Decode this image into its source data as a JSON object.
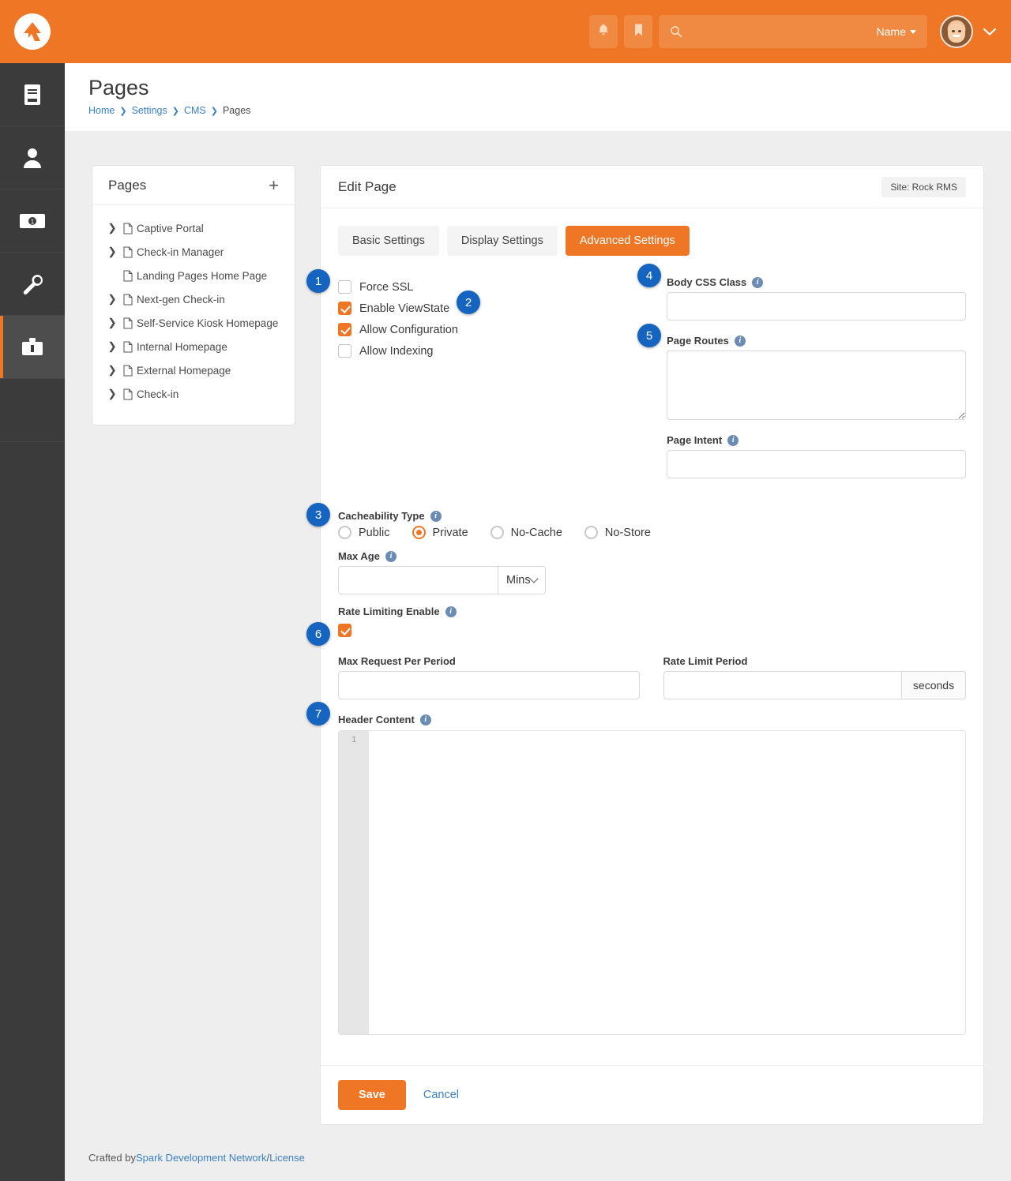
{
  "brand": {
    "accent": "#ee7624",
    "badge_color": "#1565c0",
    "link_color": "#3b81c4",
    "logo_icon": "rock-rms-logo"
  },
  "topbar": {
    "notifications_icon": "bell-icon",
    "bookmarks_icon": "bookmark-icon",
    "search_icon": "search-icon",
    "search_value": "",
    "search_placeholder": "",
    "name_label": "Name",
    "avatar_icon": "user-avatar",
    "user_caret_icon": "chevron-down-icon"
  },
  "leftnav": {
    "items": [
      {
        "icon": "book-icon",
        "active": false
      },
      {
        "icon": "person-icon",
        "active": false
      },
      {
        "icon": "money-bill-icon",
        "active": false
      },
      {
        "icon": "wrench-icon",
        "active": false
      },
      {
        "icon": "toolbox-icon",
        "active": true
      }
    ]
  },
  "header": {
    "title": "Pages",
    "breadcrumb": [
      {
        "label": "Home",
        "current": false
      },
      {
        "label": "Settings",
        "current": false
      },
      {
        "label": "CMS",
        "current": false
      },
      {
        "label": "Pages",
        "current": true
      }
    ]
  },
  "tree_panel": {
    "title": "Pages",
    "add_icon": "plus-icon",
    "items": [
      {
        "label": "Captive Portal",
        "expandable": true
      },
      {
        "label": "Check-in Manager",
        "expandable": true
      },
      {
        "label": "Landing Pages Home Page",
        "expandable": false
      },
      {
        "label": "Next-gen Check-in",
        "expandable": true
      },
      {
        "label": "Self-Service Kiosk Homepage",
        "expandable": true
      },
      {
        "label": "Internal Homepage",
        "expandable": true
      },
      {
        "label": "External Homepage",
        "expandable": true
      },
      {
        "label": "Check-in",
        "expandable": true
      }
    ]
  },
  "edit_card": {
    "title": "Edit Page",
    "site_badge": "Site: Rock RMS",
    "tabs": [
      {
        "label": "Basic Settings",
        "active": false
      },
      {
        "label": "Display Settings",
        "active": false
      },
      {
        "label": "Advanced Settings",
        "active": true
      }
    ],
    "checkboxes": [
      {
        "label": "Force SSL",
        "checked": false
      },
      {
        "label": "Enable ViewState",
        "checked": true
      },
      {
        "label": "Allow Configuration",
        "checked": true
      },
      {
        "label": "Allow Indexing",
        "checked": false
      }
    ],
    "body_css_class": {
      "label": "Body CSS Class",
      "value": "",
      "placeholder": ""
    },
    "page_routes": {
      "label": "Page Routes",
      "value": "",
      "placeholder": ""
    },
    "page_intent": {
      "label": "Page Intent",
      "value": "",
      "placeholder": ""
    },
    "cacheability": {
      "label": "Cacheability Type",
      "options": [
        {
          "label": "Public",
          "selected": false
        },
        {
          "label": "Private",
          "selected": true
        },
        {
          "label": "No-Cache",
          "selected": false
        },
        {
          "label": "No-Store",
          "selected": false
        }
      ]
    },
    "max_age": {
      "label": "Max Age",
      "value": "",
      "unit": "Mins"
    },
    "rate_limiting": {
      "label": "Rate Limiting Enable",
      "checked": true
    },
    "max_request_per_period": {
      "label": "Max Request Per Period",
      "value": ""
    },
    "rate_limit_period": {
      "label": "Rate Limit Period",
      "value": "",
      "unit": "seconds"
    },
    "header_content": {
      "label": "Header Content",
      "line_number": "1",
      "value": ""
    },
    "save_label": "Save",
    "cancel_label": "Cancel"
  },
  "badges": [
    {
      "n": "1"
    },
    {
      "n": "2"
    },
    {
      "n": "3"
    },
    {
      "n": "4"
    },
    {
      "n": "5"
    },
    {
      "n": "6"
    },
    {
      "n": "7"
    }
  ],
  "footer": {
    "prefix": "Crafted by ",
    "org": "Spark Development Network",
    "separator": " / ",
    "license": "License"
  }
}
